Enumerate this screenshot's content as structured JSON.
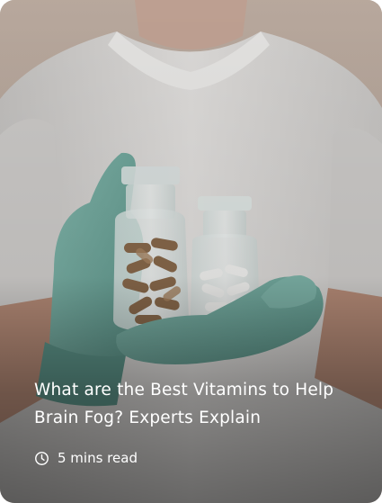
{
  "article": {
    "title": "What are the Best Vitamins to Help Brain Fog? Experts Explain",
    "read_time": "5 mins read",
    "image_icon": "photo-gloved-hands-holding-supplement-jars",
    "meta_icon": "clock-icon"
  },
  "colors": {
    "background": "#b9aaa0",
    "coat": "#dedcda",
    "glove": "#6fa79c",
    "text": "#ffffff"
  }
}
